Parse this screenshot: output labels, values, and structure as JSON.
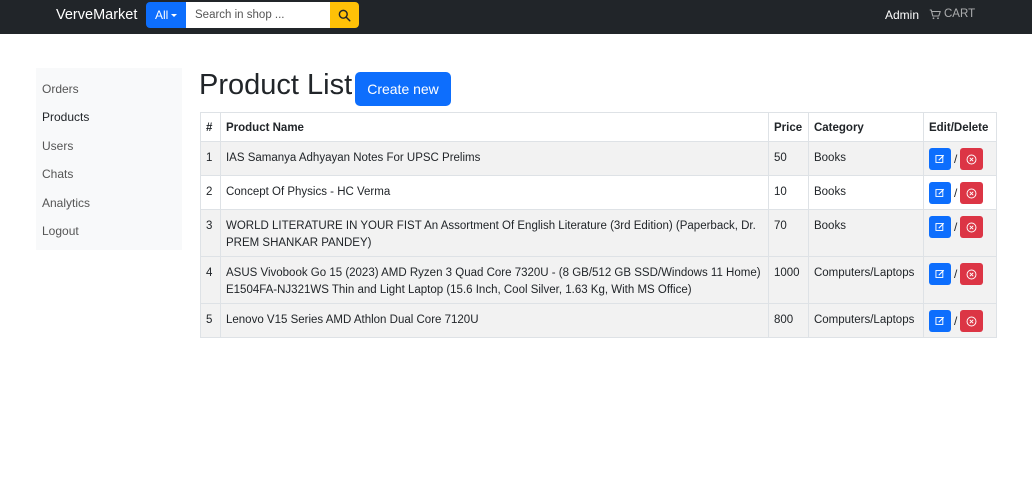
{
  "navbar": {
    "brand": "VerveMarket",
    "category_selector": "All",
    "search_placeholder": "Search in shop ...",
    "user_label": "Admin",
    "cart_label": "CART"
  },
  "sidebar": {
    "items": [
      {
        "label": "Orders"
      },
      {
        "label": "Products",
        "active": true
      },
      {
        "label": "Users"
      },
      {
        "label": "Chats"
      },
      {
        "label": "Analytics"
      },
      {
        "label": "Logout"
      }
    ]
  },
  "main": {
    "title": "Product List",
    "create_button": "Create new",
    "table": {
      "headers": [
        "#",
        "Product Name",
        "Price",
        "Category",
        "Edit/Delete"
      ],
      "rows": [
        {
          "num": "1",
          "name": "IAS Samanya Adhyayan Notes For UPSC Prelims",
          "price": "50",
          "category": "Books"
        },
        {
          "num": "2",
          "name": "Concept Of Physics - HC Verma",
          "price": "10",
          "category": "Books"
        },
        {
          "num": "3",
          "name": "WORLD LITERATURE IN YOUR FIST An Assortment Of English Literature (3rd Edition) (Paperback, Dr. PREM SHANKAR PANDEY)",
          "price": "70",
          "category": "Books"
        },
        {
          "num": "4",
          "name": "ASUS Vivobook Go 15 (2023) AMD Ryzen 3 Quad Core 7320U - (8 GB/512 GB SSD/Windows 11 Home) E1504FA-NJ321WS Thin and Light Laptop (15.6 Inch, Cool Silver, 1.63 Kg, With MS Office)",
          "price": "1000",
          "category": "Computers/Laptops"
        },
        {
          "num": "5",
          "name": "Lenovo V15 Series AMD Athlon Dual Core 7120U",
          "price": "800",
          "category": "Computers/Laptops"
        }
      ],
      "action_separator": "/"
    }
  },
  "icons": {
    "search": "search-icon",
    "cart": "cart-icon",
    "edit": "edit-icon",
    "delete": "delete-icon"
  },
  "colors": {
    "navbar_bg": "#212529",
    "primary": "#0d6efd",
    "search_button": "#ffc107",
    "danger": "#dc3545",
    "sidebar_bg": "#f8f9fa"
  }
}
